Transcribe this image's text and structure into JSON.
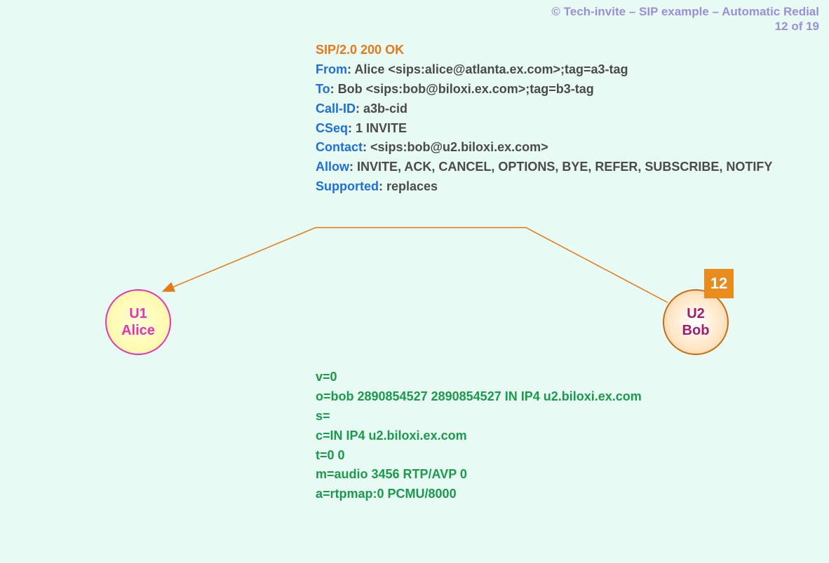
{
  "meta": {
    "copyright": "© Tech-invite – SIP example – Automatic Redial",
    "page": "12 of 19"
  },
  "step": "12",
  "nodes": {
    "u1": {
      "id": "U1",
      "name": "Alice"
    },
    "u2": {
      "id": "U2",
      "name": "Bob"
    }
  },
  "sip": {
    "status": "SIP/2.0 200 OK",
    "headers": {
      "from_key": "From",
      "from_val": ": Alice <sips:alice@atlanta.ex.com>;tag=a3-tag",
      "to_key": "To",
      "to_val": ": Bob <sips:bob@biloxi.ex.com>;tag=b3-tag",
      "callid_key": "Call-ID",
      "callid_val": ": a3b-cid",
      "cseq_key": "CSeq",
      "cseq_val": ": 1 INVITE",
      "contact_key": "Contact",
      "contact_val": ": <sips:bob@u2.biloxi.ex.com>",
      "allow_key": "Allow",
      "allow_val": ": INVITE, ACK, CANCEL, OPTIONS, BYE, REFER, SUBSCRIBE, NOTIFY",
      "supported_key": "Supported",
      "supported_val": ": replaces"
    }
  },
  "sdp": {
    "v": "v=0",
    "o": "o=bob  2890854527  2890854527  IN  IP4  u2.biloxi.ex.com",
    "s": "s=",
    "c": "c=IN  IP4  u2.biloxi.ex.com",
    "t": "t=0  0",
    "m": "m=audio  3456  RTP/AVP  0",
    "a": "a=rtpmap:0  PCMU/8000"
  }
}
